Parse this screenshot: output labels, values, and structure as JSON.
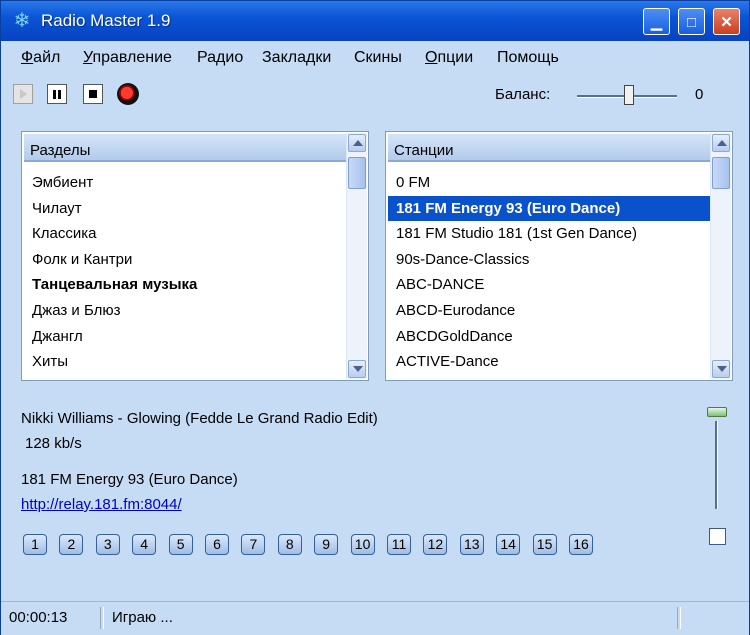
{
  "window": {
    "title": "Radio Master 1.9",
    "icon": "snowflake-icon",
    "controls": [
      "minimize",
      "maximize",
      "close"
    ]
  },
  "menu": [
    {
      "label": "Файл",
      "underline": "Ф",
      "rest": "айл"
    },
    {
      "label": "Управление",
      "underline": "У",
      "rest": "правление"
    },
    {
      "label": "Радио",
      "underline": "",
      "rest": "Радио"
    },
    {
      "label": "Закладки",
      "underline": "",
      "rest": "Закладки"
    },
    {
      "label": "Скины",
      "underline": "",
      "rest": "Скины"
    },
    {
      "label": "Опции",
      "underline": "О",
      "rest": "пции"
    },
    {
      "label": "Помощь",
      "underline": "",
      "rest": "Помощь"
    }
  ],
  "toolbar": {
    "balance_label": "Баланс:",
    "balance_value": "0"
  },
  "sections": {
    "header": "Разделы",
    "items": [
      "Эмбиент",
      "Чилаут",
      "Классика",
      "Фолк и Кантри",
      "Танцевальная музыка",
      "Джаз и Блюз",
      "Джангл",
      "Хиты"
    ],
    "bold_index": 4
  },
  "stations": {
    "header": "Станции",
    "items": [
      "0 FM",
      "181 FM Energy 93 (Euro Dance)",
      "181 FM Studio 181 (1st Gen Dance)",
      "90s-Dance-Classics",
      "ABC-DANCE",
      "ABCD-Eurodance",
      "ABCDGoldDance",
      "ACTIVE-Dance"
    ],
    "selected_index": 1
  },
  "now_playing": {
    "track": "Nikki Williams - Glowing (Fedde Le Grand Radio Edit)",
    "bitrate": "128 kb/s",
    "station": "181 FM Energy 93 (Euro Dance)",
    "url": "http://relay.181.fm:8044/"
  },
  "presets": [
    "1",
    "2",
    "3",
    "4",
    "5",
    "6",
    "7",
    "8",
    "9",
    "10",
    "11",
    "12",
    "13",
    "14",
    "15",
    "16"
  ],
  "status": {
    "time": "00:00:13",
    "text": "Играю ..."
  },
  "colors": {
    "titlebar": "#0a55d6",
    "window_bg": "#c6dcf5",
    "selection": "#0a52cc",
    "link": "#0000cc"
  }
}
